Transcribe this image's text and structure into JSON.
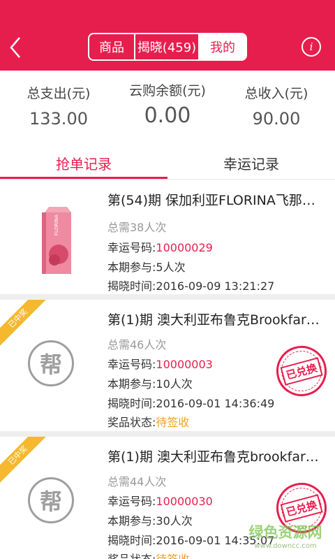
{
  "header": {
    "back_icon": "chevron-left-icon",
    "segments": [
      {
        "label": "商品"
      },
      {
        "label": "揭晓(459)"
      },
      {
        "label": "我的"
      }
    ],
    "info_icon": "info-circle-icon",
    "info_glyph": "i",
    "accent": "#e61e4e"
  },
  "summary": [
    {
      "label": "总支出(元)",
      "value": "133.00"
    },
    {
      "label": "云购余额(元)",
      "value": "0.00"
    },
    {
      "label": "总收入(元)",
      "value": "90.00"
    }
  ],
  "tabs": [
    {
      "label": "抢单记录",
      "active": true
    },
    {
      "label": "幸运记录",
      "active": false
    }
  ],
  "records": [
    {
      "title": "第(54)期 保加利亚FLORINA飞那…",
      "total_needed": "总需38人次",
      "lucky_label": "幸运号码:",
      "lucky_number": "10000029",
      "participation": "本期参与:5人次",
      "reveal_time": "揭晓时间:2016-09-09 13:21:27",
      "image_brand": "FLORINA"
    },
    {
      "title": "第(1)期 澳大利亚布鲁克Brookfar…",
      "total_needed": "总需46人次",
      "lucky_label": "幸运号码:",
      "lucky_number": "10000003",
      "participation": "本期参与:10人次",
      "reveal_time": "揭晓时间:2016-09-01 14:36:49",
      "prize_label": "奖品状态:",
      "prize_status": "待签收",
      "ribbon": "已中奖",
      "avatar_char": "帮",
      "stamp": "已兑换"
    },
    {
      "title": "第(1)期 澳大利亚布鲁克brookfar…",
      "total_needed": "总需44人次",
      "lucky_label": "幸运号码:",
      "lucky_number": "10000030",
      "participation": "本期参与:30人次",
      "reveal_time": "揭晓时间:2016-09-01 14:35:07",
      "prize_label": "奖品状态:",
      "prize_status": "待签收",
      "ribbon": "已中奖",
      "avatar_char": "帮",
      "stamp": "已兑换"
    }
  ],
  "watermark": {
    "main": "绿色资源网",
    "sub": "www.downcc.com"
  }
}
